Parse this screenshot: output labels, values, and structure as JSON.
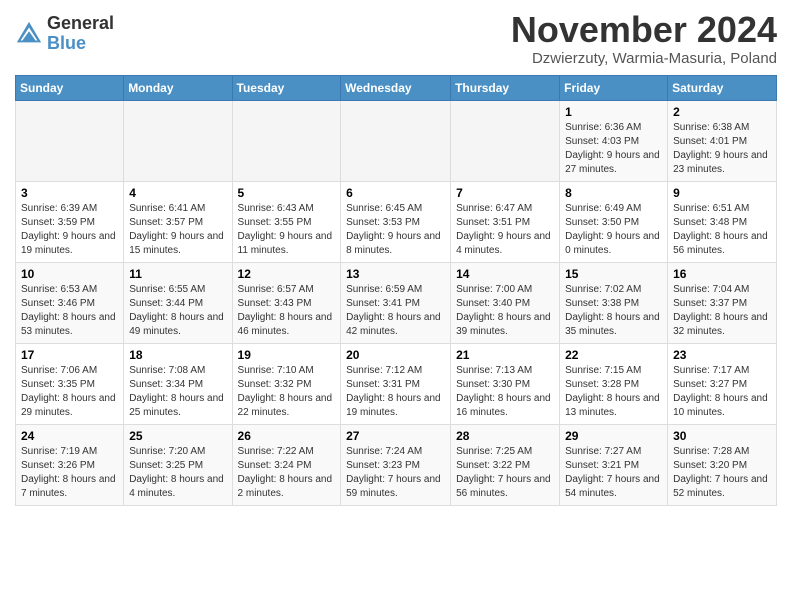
{
  "header": {
    "logo_line1": "General",
    "logo_line2": "Blue",
    "title": "November 2024",
    "subtitle": "Dzwierzuty, Warmia-Masuria, Poland"
  },
  "weekdays": [
    "Sunday",
    "Monday",
    "Tuesday",
    "Wednesday",
    "Thursday",
    "Friday",
    "Saturday"
  ],
  "weeks": [
    [
      {
        "day": "",
        "detail": ""
      },
      {
        "day": "",
        "detail": ""
      },
      {
        "day": "",
        "detail": ""
      },
      {
        "day": "",
        "detail": ""
      },
      {
        "day": "",
        "detail": ""
      },
      {
        "day": "1",
        "detail": "Sunrise: 6:36 AM\nSunset: 4:03 PM\nDaylight: 9 hours and 27 minutes."
      },
      {
        "day": "2",
        "detail": "Sunrise: 6:38 AM\nSunset: 4:01 PM\nDaylight: 9 hours and 23 minutes."
      }
    ],
    [
      {
        "day": "3",
        "detail": "Sunrise: 6:39 AM\nSunset: 3:59 PM\nDaylight: 9 hours and 19 minutes."
      },
      {
        "day": "4",
        "detail": "Sunrise: 6:41 AM\nSunset: 3:57 PM\nDaylight: 9 hours and 15 minutes."
      },
      {
        "day": "5",
        "detail": "Sunrise: 6:43 AM\nSunset: 3:55 PM\nDaylight: 9 hours and 11 minutes."
      },
      {
        "day": "6",
        "detail": "Sunrise: 6:45 AM\nSunset: 3:53 PM\nDaylight: 9 hours and 8 minutes."
      },
      {
        "day": "7",
        "detail": "Sunrise: 6:47 AM\nSunset: 3:51 PM\nDaylight: 9 hours and 4 minutes."
      },
      {
        "day": "8",
        "detail": "Sunrise: 6:49 AM\nSunset: 3:50 PM\nDaylight: 9 hours and 0 minutes."
      },
      {
        "day": "9",
        "detail": "Sunrise: 6:51 AM\nSunset: 3:48 PM\nDaylight: 8 hours and 56 minutes."
      }
    ],
    [
      {
        "day": "10",
        "detail": "Sunrise: 6:53 AM\nSunset: 3:46 PM\nDaylight: 8 hours and 53 minutes."
      },
      {
        "day": "11",
        "detail": "Sunrise: 6:55 AM\nSunset: 3:44 PM\nDaylight: 8 hours and 49 minutes."
      },
      {
        "day": "12",
        "detail": "Sunrise: 6:57 AM\nSunset: 3:43 PM\nDaylight: 8 hours and 46 minutes."
      },
      {
        "day": "13",
        "detail": "Sunrise: 6:59 AM\nSunset: 3:41 PM\nDaylight: 8 hours and 42 minutes."
      },
      {
        "day": "14",
        "detail": "Sunrise: 7:00 AM\nSunset: 3:40 PM\nDaylight: 8 hours and 39 minutes."
      },
      {
        "day": "15",
        "detail": "Sunrise: 7:02 AM\nSunset: 3:38 PM\nDaylight: 8 hours and 35 minutes."
      },
      {
        "day": "16",
        "detail": "Sunrise: 7:04 AM\nSunset: 3:37 PM\nDaylight: 8 hours and 32 minutes."
      }
    ],
    [
      {
        "day": "17",
        "detail": "Sunrise: 7:06 AM\nSunset: 3:35 PM\nDaylight: 8 hours and 29 minutes."
      },
      {
        "day": "18",
        "detail": "Sunrise: 7:08 AM\nSunset: 3:34 PM\nDaylight: 8 hours and 25 minutes."
      },
      {
        "day": "19",
        "detail": "Sunrise: 7:10 AM\nSunset: 3:32 PM\nDaylight: 8 hours and 22 minutes."
      },
      {
        "day": "20",
        "detail": "Sunrise: 7:12 AM\nSunset: 3:31 PM\nDaylight: 8 hours and 19 minutes."
      },
      {
        "day": "21",
        "detail": "Sunrise: 7:13 AM\nSunset: 3:30 PM\nDaylight: 8 hours and 16 minutes."
      },
      {
        "day": "22",
        "detail": "Sunrise: 7:15 AM\nSunset: 3:28 PM\nDaylight: 8 hours and 13 minutes."
      },
      {
        "day": "23",
        "detail": "Sunrise: 7:17 AM\nSunset: 3:27 PM\nDaylight: 8 hours and 10 minutes."
      }
    ],
    [
      {
        "day": "24",
        "detail": "Sunrise: 7:19 AM\nSunset: 3:26 PM\nDaylight: 8 hours and 7 minutes."
      },
      {
        "day": "25",
        "detail": "Sunrise: 7:20 AM\nSunset: 3:25 PM\nDaylight: 8 hours and 4 minutes."
      },
      {
        "day": "26",
        "detail": "Sunrise: 7:22 AM\nSunset: 3:24 PM\nDaylight: 8 hours and 2 minutes."
      },
      {
        "day": "27",
        "detail": "Sunrise: 7:24 AM\nSunset: 3:23 PM\nDaylight: 7 hours and 59 minutes."
      },
      {
        "day": "28",
        "detail": "Sunrise: 7:25 AM\nSunset: 3:22 PM\nDaylight: 7 hours and 56 minutes."
      },
      {
        "day": "29",
        "detail": "Sunrise: 7:27 AM\nSunset: 3:21 PM\nDaylight: 7 hours and 54 minutes."
      },
      {
        "day": "30",
        "detail": "Sunrise: 7:28 AM\nSunset: 3:20 PM\nDaylight: 7 hours and 52 minutes."
      }
    ]
  ]
}
